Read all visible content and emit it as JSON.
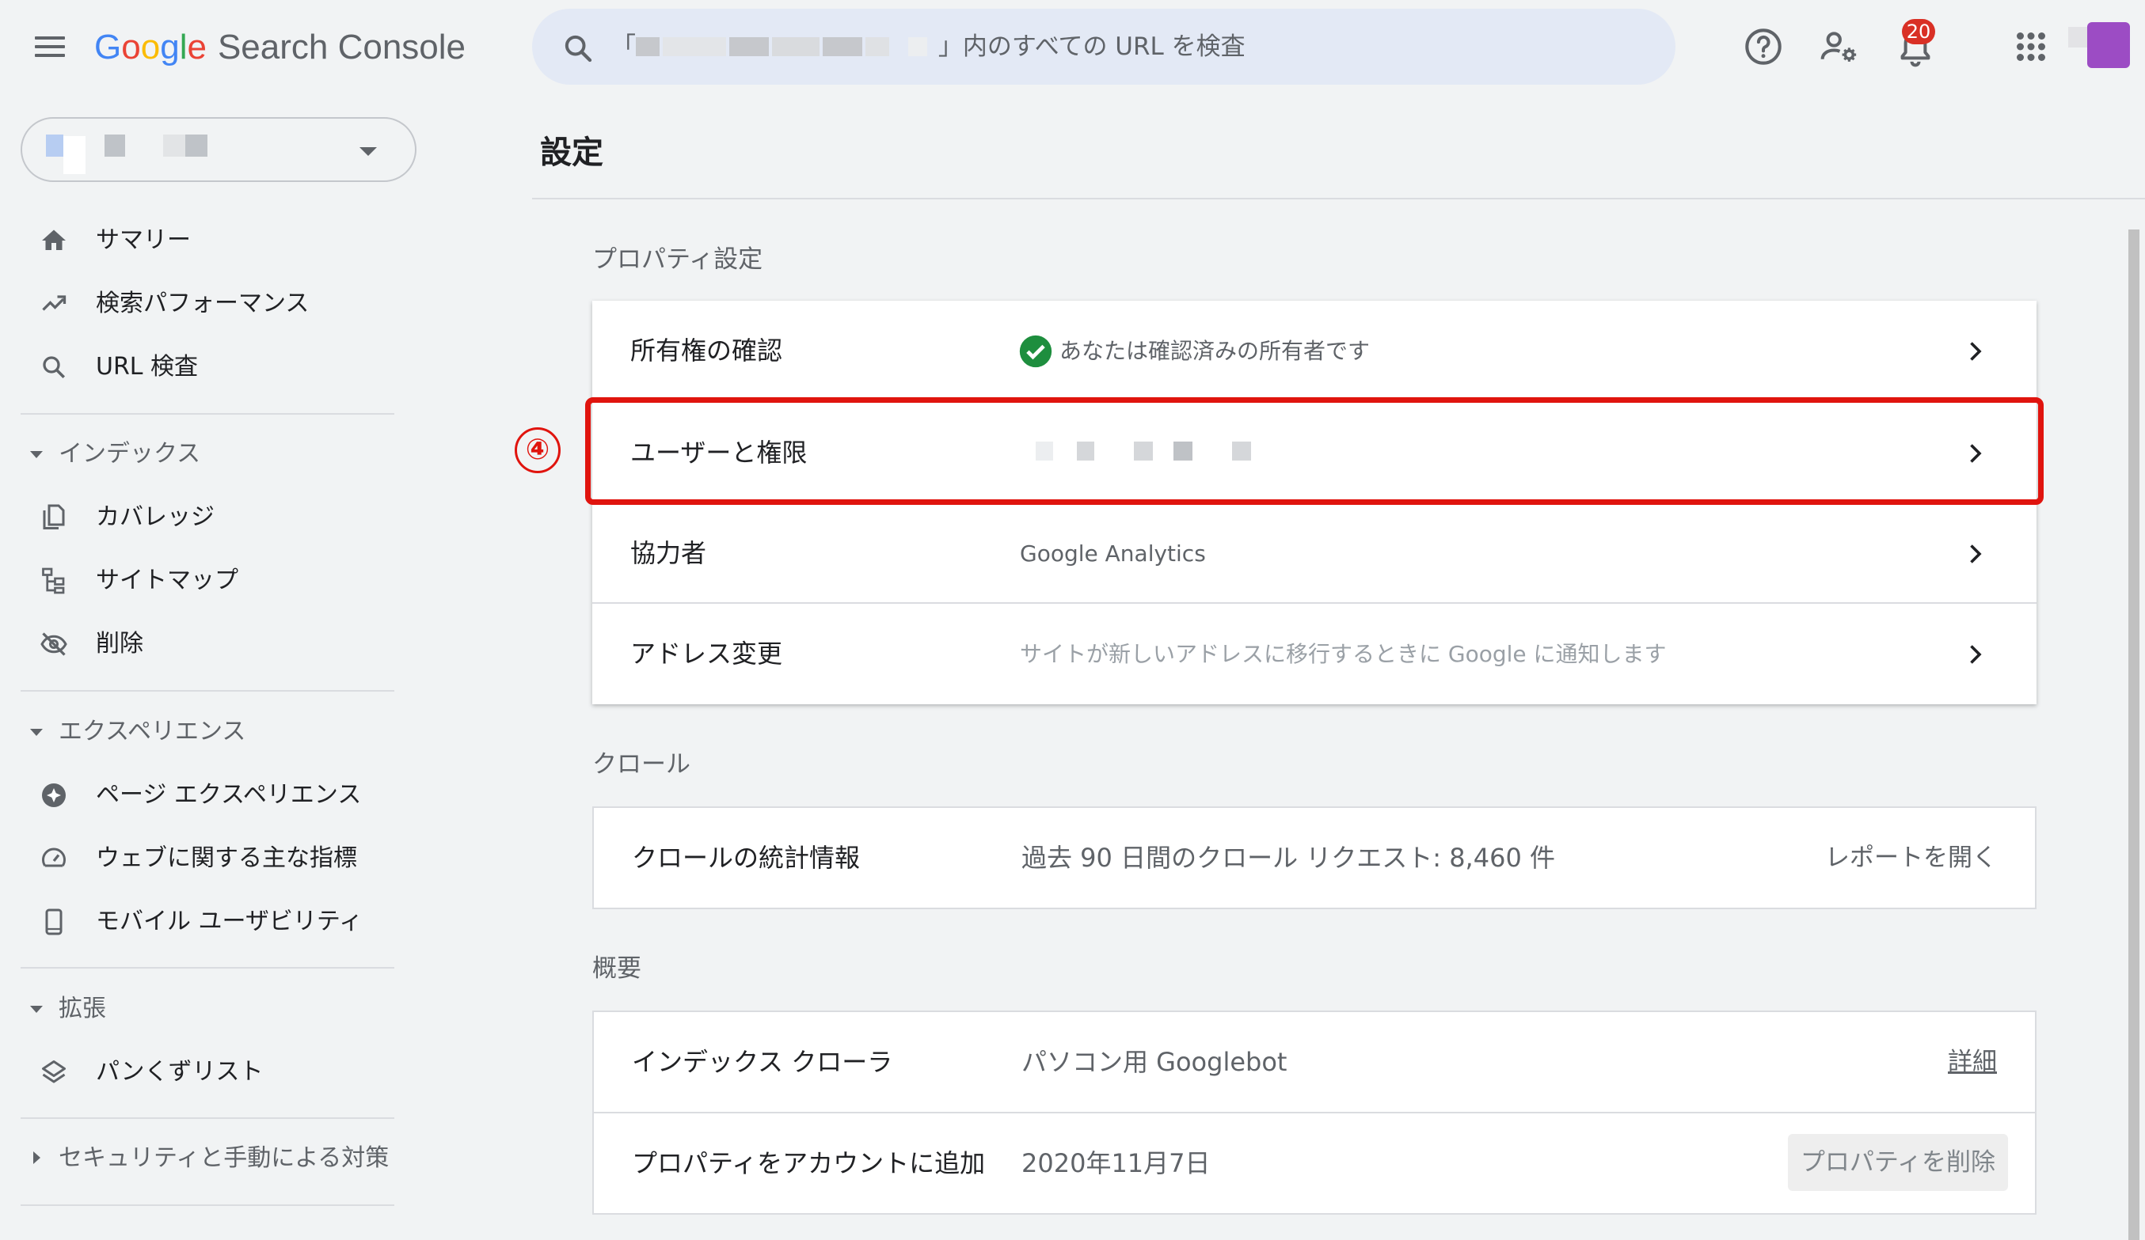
{
  "header": {
    "logo_google": [
      "G",
      "o",
      "o",
      "g",
      "l",
      "e"
    ],
    "logo_product": "Search Console",
    "search_text": "」内のすべての URL を検査",
    "search_open_bracket": "「",
    "notification_count": "20",
    "colors": {
      "accent": "#1a73e8",
      "badge": "#d93025",
      "avatar": "#9c4cc4"
    }
  },
  "sidebar": {
    "nav_top": [
      {
        "label": "サマリー",
        "icon": "home-icon"
      },
      {
        "label": "検索パフォーマンス",
        "icon": "trending-up-icon"
      },
      {
        "label": "URL 検査",
        "icon": "search-icon"
      }
    ],
    "sections": [
      {
        "label": "インデックス",
        "items": [
          {
            "label": "カバレッジ",
            "icon": "file-copy-icon"
          },
          {
            "label": "サイトマップ",
            "icon": "sitemap-icon"
          },
          {
            "label": "削除",
            "icon": "visibility-off-icon"
          }
        ]
      },
      {
        "label": "エクスペリエンス",
        "items": [
          {
            "label": "ページ エクスペリエンス",
            "icon": "plus-circle-icon"
          },
          {
            "label": "ウェブに関する主な指標",
            "icon": "speed-gauge-icon"
          },
          {
            "label": "モバイル ユーザビリティ",
            "icon": "smartphone-icon"
          }
        ]
      },
      {
        "label": "拡張",
        "items": [
          {
            "label": "パンくずリスト",
            "icon": "layers-icon"
          }
        ]
      },
      {
        "label": "セキュリティと手動による対策",
        "items": []
      }
    ]
  },
  "main": {
    "title": "設定",
    "property_settings": {
      "label": "プロパティ設定",
      "rows": [
        {
          "label": "所有権の確認",
          "value": "あなたは確認済みの所有者です"
        },
        {
          "label": "ユーザーと権限",
          "value": ""
        },
        {
          "label": "協力者",
          "value": "Google Analytics"
        },
        {
          "label": "アドレス変更",
          "value": "サイトが新しいアドレスに移行するときに Google に通知します"
        }
      ]
    },
    "crawl": {
      "label": "クロール",
      "rows": [
        {
          "label": "クロールの統計情報",
          "value": "過去 90 日間のクロール リクエスト: 8,460 件",
          "action": "レポートを開く"
        }
      ]
    },
    "overview": {
      "label": "概要",
      "rows": [
        {
          "label": "インデックス クローラ",
          "value": "パソコン用 Googlebot",
          "action": "詳細"
        },
        {
          "label": "プロパティをアカウントに追加",
          "value": "2020年11月7日",
          "action": "プロパティを削除"
        }
      ]
    },
    "annotation_step": "④"
  }
}
